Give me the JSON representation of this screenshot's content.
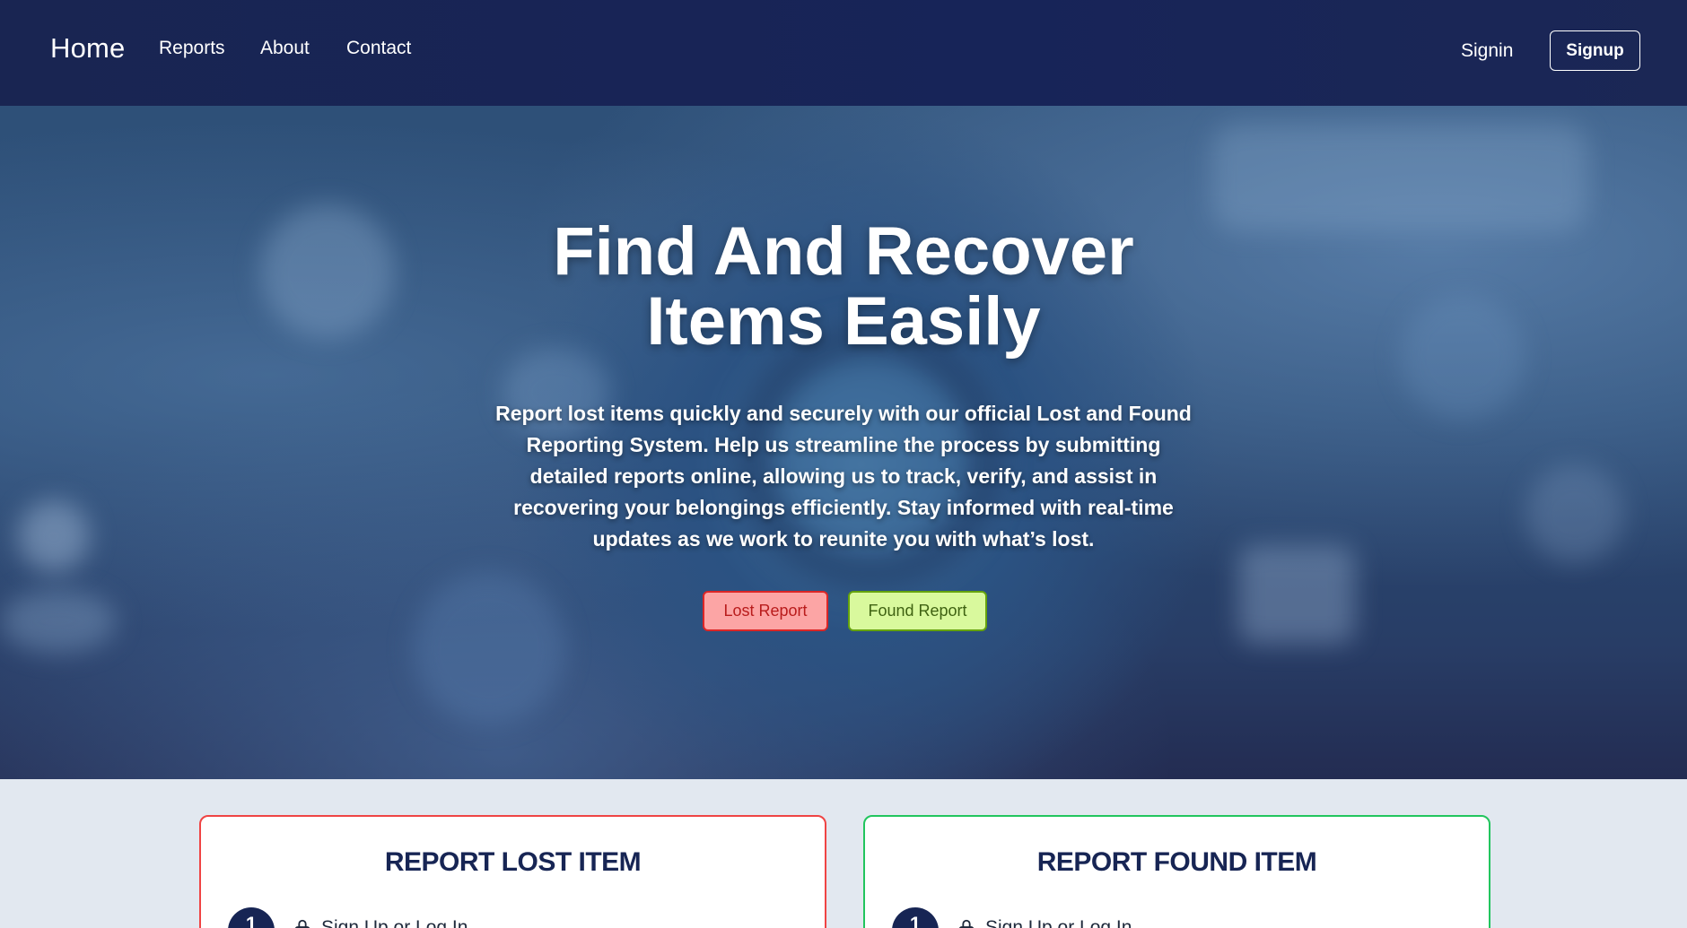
{
  "nav": {
    "brand": "Home",
    "links": [
      "Reports",
      "About",
      "Contact"
    ],
    "signin": "Signin",
    "signup": "Signup"
  },
  "hero": {
    "title_line1": "Find And Recover",
    "title_line2": "Items Easily",
    "description": "Report lost items quickly and securely with our official Lost and Found Reporting System. Help us streamline the process by submitting detailed reports online, allowing us to track, verify, and assist in recovering your belongings efficiently. Stay informed with real-time updates as we work to reunite you with what’s lost.",
    "lost_button": "Lost Report",
    "found_button": "Found Report"
  },
  "cards": {
    "lost": {
      "title": "REPORT LOST ITEM",
      "step_number": "1",
      "step_icon": "lock-icon",
      "step_text": "Sign Up or Log In"
    },
    "found": {
      "title": "REPORT FOUND ITEM",
      "step_number": "1",
      "step_icon": "lock-icon",
      "step_text": "Sign Up or Log In"
    }
  },
  "colors": {
    "navbar": "#172554",
    "lost_accent": "#ef4444",
    "found_accent": "#22c55e",
    "page_bg": "#e2e8f0"
  }
}
